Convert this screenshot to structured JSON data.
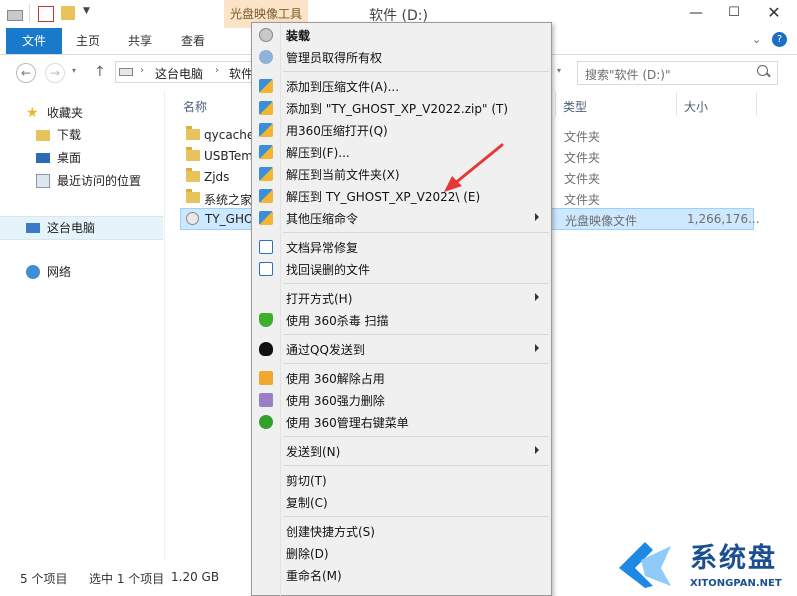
{
  "window": {
    "title": "软件 (D:)",
    "context_tool_tab": "光盘映像工具",
    "minimize_glyph": "—",
    "maximize_glyph": "☐",
    "close_glyph": "✕"
  },
  "ribbon": {
    "tabs": [
      "文件",
      "主页",
      "共享",
      "查看"
    ]
  },
  "navigation": {
    "back_glyph": "←",
    "forward_glyph": "→",
    "up_glyph": "↑",
    "breadcrumb": [
      "这台电脑",
      "软件"
    ],
    "search_placeholder": "搜索\"软件 (D:)\""
  },
  "nav_pane": {
    "items": [
      {
        "label": "收藏夹",
        "icon": "star-icon"
      },
      {
        "label": "下载",
        "icon": "download-folder-icon"
      },
      {
        "label": "桌面",
        "icon": "desktop-icon"
      },
      {
        "label": "最近访问的位置",
        "icon": "recent-places-icon"
      },
      {
        "label": "这台电脑",
        "icon": "computer-icon"
      },
      {
        "label": "网络",
        "icon": "network-icon"
      }
    ]
  },
  "file_list": {
    "columns": {
      "name": "名称",
      "type": "类型",
      "size": "大小"
    },
    "rows": [
      {
        "name": "qycache",
        "type": "文件夹",
        "size": "",
        "icon": "folder-icon"
      },
      {
        "name": "USBTem",
        "type": "文件夹",
        "size": "",
        "icon": "folder-icon"
      },
      {
        "name": "Zjds",
        "type": "文件夹",
        "size": "",
        "icon": "folder-icon"
      },
      {
        "name": "系统之家",
        "type": "文件夹",
        "size": "",
        "icon": "folder-icon"
      },
      {
        "name": "TY_GHOS",
        "type": "光盘映像文件",
        "size": "1,266,176...",
        "icon": "disc-image-icon",
        "selected": true
      }
    ]
  },
  "status_bar": {
    "item_count": "5 个项目",
    "selection": "选中 1 个项目",
    "size": "1.20 GB"
  },
  "context_menu": {
    "items": [
      {
        "label": "装载",
        "bold": true,
        "icon": "disc-mount-icon"
      },
      {
        "label": "管理员取得所有权",
        "icon": "admin-users-icon"
      },
      {
        "label": "添加到压缩文件(A)...",
        "icon": "archive-icon"
      },
      {
        "label": "添加到 \"TY_GHOST_XP_V2022.zip\" (T)",
        "icon": "archive-icon"
      },
      {
        "label": "用360压缩打开(Q)",
        "icon": "archive-icon"
      },
      {
        "label": "解压到(F)...",
        "icon": "archive-icon"
      },
      {
        "label": "解压到当前文件夹(X)",
        "icon": "archive-icon"
      },
      {
        "label": "解压到 TY_GHOST_XP_V2022\\ (E)",
        "icon": "archive-icon"
      },
      {
        "label": "其他压缩命令",
        "icon": "archive-icon",
        "submenu": true
      },
      {
        "label": "文档异常修复",
        "icon": "doc-repair-icon"
      },
      {
        "label": "找回误删的文件",
        "icon": "file-recover-icon"
      },
      {
        "label": "打开方式(H)",
        "icon": "",
        "submenu": true
      },
      {
        "label": "使用 360杀毒 扫描",
        "icon": "shield-icon"
      },
      {
        "label": "通过QQ发送到",
        "icon": "qq-penguin-icon",
        "submenu": true
      },
      {
        "label": "使用 360解除占用",
        "icon": "unlock-icon"
      },
      {
        "label": "使用 360强力删除",
        "icon": "shred-icon"
      },
      {
        "label": "使用 360管理右键菜单",
        "icon": "menu-manage-icon"
      },
      {
        "label": "发送到(N)",
        "icon": "",
        "submenu": true
      },
      {
        "label": "剪切(T)",
        "icon": ""
      },
      {
        "label": "复制(C)",
        "icon": ""
      },
      {
        "label": "创建快捷方式(S)",
        "icon": ""
      },
      {
        "label": "删除(D)",
        "icon": ""
      },
      {
        "label": "重命名(M)",
        "icon": ""
      }
    ]
  },
  "watermark": {
    "text": "系统盘",
    "url": "XITONGPAN.NET"
  },
  "colors": {
    "accent": "#1979ca",
    "selection": "#cde8ff",
    "annotation_arrow": "#e53935"
  }
}
